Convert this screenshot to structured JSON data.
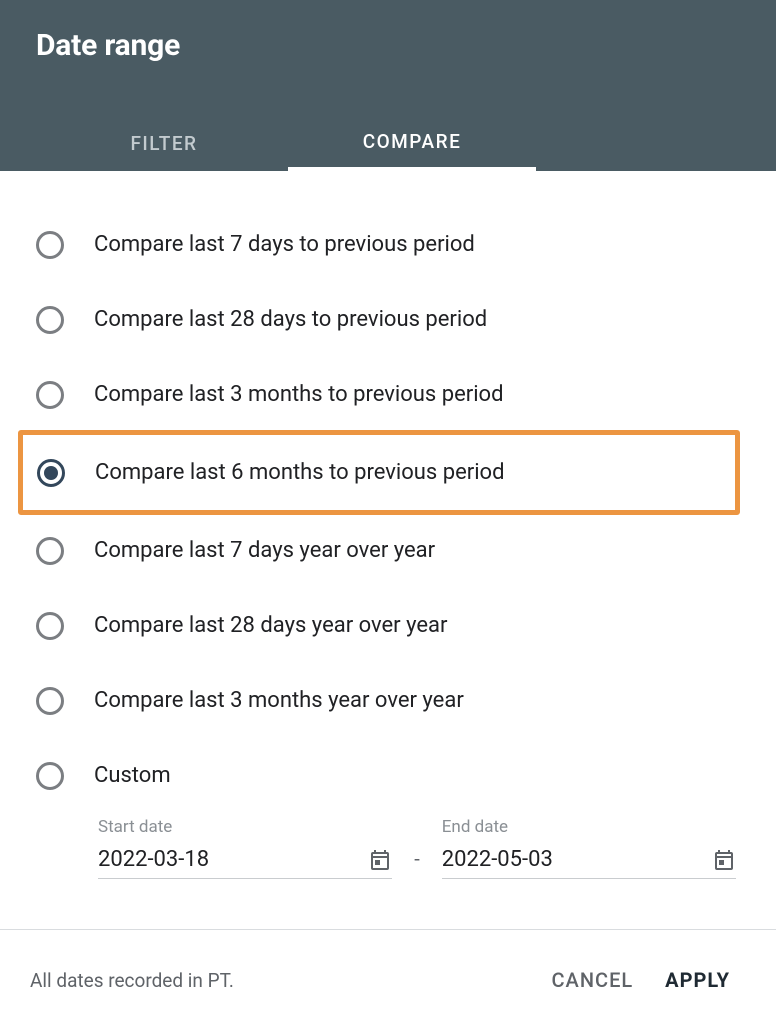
{
  "header": {
    "title": "Date range",
    "tabs": {
      "filter": "FILTER",
      "compare": "COMPARE",
      "active": "compare"
    }
  },
  "options": [
    {
      "id": "7d-prev",
      "label": "Compare last 7 days to previous period",
      "selected": false
    },
    {
      "id": "28d-prev",
      "label": "Compare last 28 days to previous period",
      "selected": false
    },
    {
      "id": "3m-prev",
      "label": "Compare last 3 months to previous period",
      "selected": false
    },
    {
      "id": "6m-prev",
      "label": "Compare last 6 months to previous period",
      "selected": true,
      "highlighted": true
    },
    {
      "id": "7d-yoy",
      "label": "Compare last 7 days year over year",
      "selected": false
    },
    {
      "id": "28d-yoy",
      "label": "Compare last 28 days year over year",
      "selected": false
    },
    {
      "id": "3m-yoy",
      "label": "Compare last 3 months year over year",
      "selected": false
    },
    {
      "id": "custom",
      "label": "Custom",
      "selected": false
    }
  ],
  "custom": {
    "start_label": "Start date",
    "end_label": "End date",
    "start_value": "2022-03-18",
    "end_value": "2022-05-03",
    "separator": "-"
  },
  "footer": {
    "note": "All dates recorded in PT.",
    "cancel": "CANCEL",
    "apply": "APPLY"
  }
}
